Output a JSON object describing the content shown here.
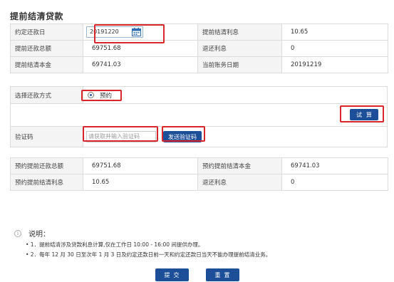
{
  "page": {
    "title": "提前结清贷款"
  },
  "info": {
    "agreed_date_label": "约定还款日",
    "agreed_date_value": "20191220",
    "settle_interest_label": "提前结清利息",
    "settle_interest_value": "10.65",
    "repay_total_label": "提前还款总额",
    "repay_total_value": "69751.68",
    "refund_interest_label": "退还利息",
    "refund_interest_value": "0",
    "settle_principal_label": "提前结清本金",
    "settle_principal_value": "69741.03",
    "account_date_label": "当前账务日期",
    "account_date_value": "20191219"
  },
  "method": {
    "label": "选择还款方式",
    "option": "预约",
    "calc_button": "试算",
    "code_label": "验证码",
    "code_placeholder": "请获取并输入验证码",
    "send_code_button": "发送验证码"
  },
  "result": {
    "booked_total_label": "预约提前还款总额",
    "booked_total_value": "69751.68",
    "booked_principal_label": "预约提前结清本金",
    "booked_principal_value": "69741.03",
    "booked_interest_label": "预约提前结清利息",
    "booked_interest_value": "10.65",
    "refund_interest_label": "退还利息",
    "refund_interest_value": "0"
  },
  "notes": {
    "title": "说明：",
    "icon": "info-icon",
    "lines": [
      "• 1．提前结清涉及贷款利息计算,仅在工作日 10:00 - 16:00 间提供办理。",
      "• 2．每年 12 月 30 日至次年 1 月 3 日及约定还款日前一天和约定还款日当天不能办理提前结清业务。"
    ]
  },
  "actions": {
    "submit": "提交",
    "reset": "重置"
  },
  "colors": {
    "primary": "#1d4f98",
    "highlight": "#d7262c",
    "border": "#dcdcdc",
    "label_bg": "#f4f4f4"
  }
}
